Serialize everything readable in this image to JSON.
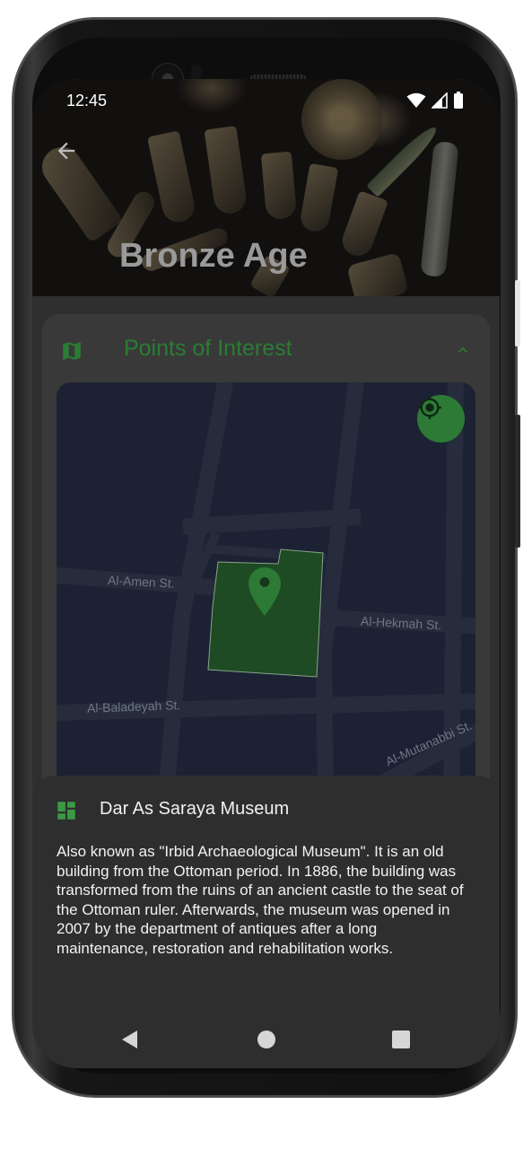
{
  "status_bar": {
    "time": "12:45"
  },
  "header": {
    "title": "Bronze Age"
  },
  "points_of_interest": {
    "title": "Points of Interest",
    "streets": [
      "Al-Amen St.",
      "Al-Hekmah St.",
      "Al-Baladeyah St.",
      "Al-Mutanabbi St."
    ]
  },
  "place": {
    "name": "Dar As Saraya Museum",
    "description": "Also known as \"Irbid Archaeological Museum\". It is an old building from the Ottoman period. In 1886, the building was transformed from the ruins of an ancient castle to the seat of the Ottoman ruler. Afterwards, the museum was opened in 2007 by the department of antiques after a long maintenance, restoration and rehabilitation works."
  },
  "colors": {
    "accent": "#2a7d33",
    "fab": "#2d7a36",
    "map_background": "#1c2233",
    "map_road": "#262c3b",
    "poi_fill": "#1e4a24",
    "card": "#393939",
    "sheet": "#2e2e2e"
  },
  "icons": [
    "back-arrow-icon",
    "map-icon",
    "chevron-up-icon",
    "my-location-icon",
    "map-pin-icon",
    "dashboard-icon",
    "wifi-icon",
    "cell-signal-icon",
    "battery-icon",
    "nav-back-icon",
    "nav-home-icon",
    "nav-recents-icon"
  ]
}
